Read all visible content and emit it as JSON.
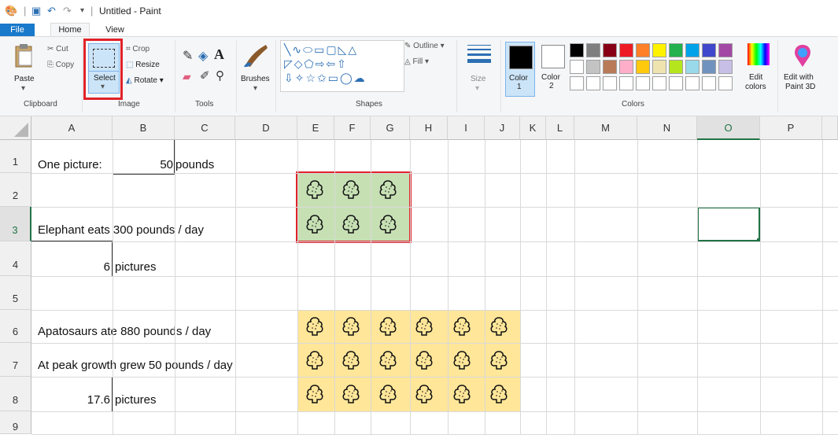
{
  "window": {
    "title": "Untitled - Paint"
  },
  "tabs": {
    "file": "File",
    "home": "Home",
    "view": "View"
  },
  "ribbon": {
    "clipboard": {
      "paste": "Paste",
      "cut": "Cut",
      "copy": "Copy",
      "label": "Clipboard"
    },
    "image": {
      "select": "Select",
      "crop": "Crop",
      "resize": "Resize",
      "rotate": "Rotate",
      "label": "Image"
    },
    "tools": {
      "label": "Tools"
    },
    "brushes": {
      "label": "Brushes"
    },
    "shapes": {
      "label": "Shapes",
      "outline": "Outline",
      "fill": "Fill"
    },
    "size": {
      "label": "Size"
    },
    "colors": {
      "color1": "Color",
      "color1_num": "1",
      "color2": "Color",
      "color2_num": "2",
      "edit": "Edit",
      "edit2": "colors",
      "label": "Colors"
    },
    "paint3d": {
      "line1": "Edit with",
      "line2": "Paint 3D"
    },
    "palette_row1": [
      "#000000",
      "#7f7f7f",
      "#880015",
      "#ed1c24",
      "#ff7f27",
      "#fff200",
      "#22b14c",
      "#00a2e8",
      "#3f48cc",
      "#a349a4"
    ],
    "palette_row2": [
      "#ffffff",
      "#c3c3c3",
      "#b97a57",
      "#ffaec9",
      "#ffc90e",
      "#efe4b0",
      "#b5e61d",
      "#99d9ea",
      "#7092be",
      "#c8bfe7"
    ],
    "palette_row3": [
      "#ffffff",
      "#ffffff",
      "#ffffff",
      "#ffffff",
      "#ffffff",
      "#ffffff",
      "#ffffff",
      "#ffffff",
      "#ffffff",
      "#ffffff"
    ]
  },
  "sheet": {
    "columns": [
      "A",
      "B",
      "C",
      "D",
      "E",
      "F",
      "G",
      "H",
      "I",
      "J",
      "K",
      "L",
      "M",
      "N",
      "O",
      "P"
    ],
    "rows": [
      "1",
      "2",
      "3",
      "4",
      "5",
      "6",
      "7",
      "8",
      "9"
    ],
    "cells": {
      "a1": "One picture:",
      "b1": "50",
      "c1": "pounds",
      "a3": "Elephant eats 300 pounds / day",
      "a4": "6",
      "b4": "pictures",
      "a6": "Apatosaurs ate 880 pounds / day",
      "a7": "At peak growth grew 50 pounds / day",
      "a8": "17.6",
      "b8": "pictures"
    },
    "green_box_color": "#c6e0b4",
    "yellow_box_color": "#ffe699",
    "highlight_color": "#e0222a"
  }
}
